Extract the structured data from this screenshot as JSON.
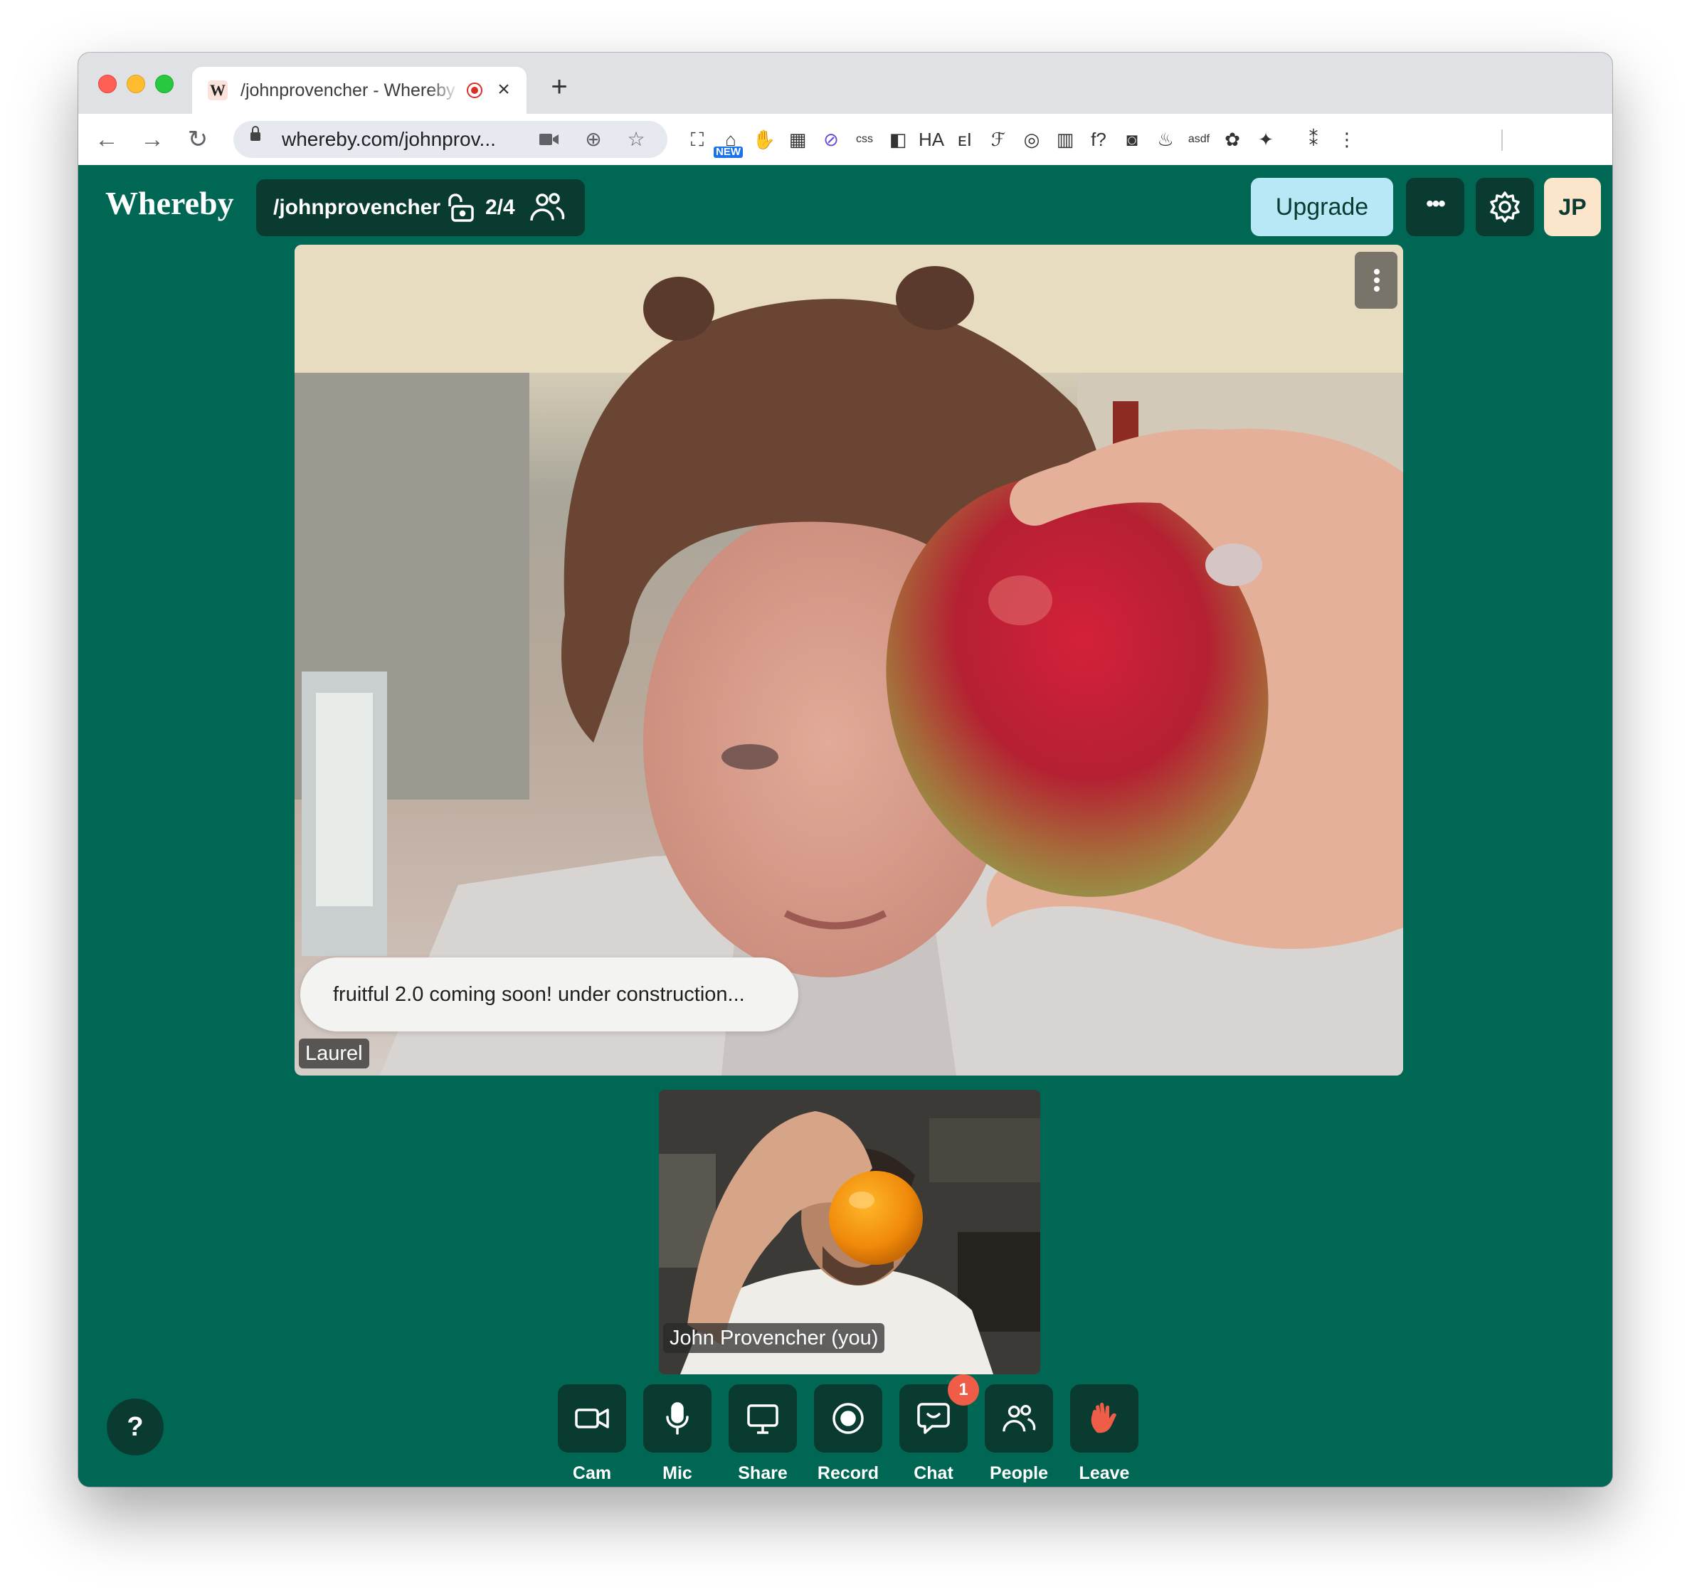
{
  "browser": {
    "tab": {
      "favicon_letter": "W",
      "title": "/johnprovencher - Whereby",
      "recording": true
    },
    "new_tab_label": "+",
    "omnibox": {
      "url": "whereby.com/johnprov..."
    },
    "extensions": [
      {
        "name": "screenshot-extension-icon",
        "glyph": "⛶"
      },
      {
        "name": "new-extension-icon",
        "glyph": "⌂"
      },
      {
        "name": "stop-hand-extension-icon",
        "glyph": "✋"
      },
      {
        "name": "sheets-extension-icon",
        "glyph": "▦"
      },
      {
        "name": "purple-circle-extension-icon",
        "glyph": "⊘"
      },
      {
        "name": "css-extension-icon",
        "glyph": "css"
      },
      {
        "name": "layout-extension-icon",
        "glyph": "◧"
      },
      {
        "name": "ha-extension-icon",
        "glyph": "HA"
      },
      {
        "name": "ei-extension-icon",
        "glyph": "ᴇI"
      },
      {
        "name": "font-extension-icon",
        "glyph": "ℱ"
      },
      {
        "name": "spiral-extension-icon",
        "glyph": "◎"
      },
      {
        "name": "color-bars-extension-icon",
        "glyph": "▥"
      },
      {
        "name": "whatfont-extension-icon",
        "glyph": "f?"
      },
      {
        "name": "camera-extension-icon",
        "glyph": "◙"
      },
      {
        "name": "flame-extension-icon",
        "glyph": "♨"
      },
      {
        "name": "asdf-extension-icon",
        "glyph": "asdf"
      },
      {
        "name": "brain-extension-icon",
        "glyph": "✿"
      },
      {
        "name": "squirrel-extension-icon",
        "glyph": "✦"
      },
      {
        "name": "dots-extension-icon",
        "glyph": "⁑"
      },
      {
        "name": "chrome-menu-icon",
        "glyph": "⋮"
      }
    ]
  },
  "header": {
    "logo": "Whereby",
    "room_name": "/johnprovencher",
    "room_count": "2/4",
    "upgrade_label": "Upgrade",
    "more_label": "•••",
    "avatar_initials": "JP",
    "accent": "#b8e8f6",
    "avatar_bg": "#fbe6cc"
  },
  "main_video": {
    "participant_name": "Laurel",
    "chat_bubble": "fruitful 2.0 coming soon! under construction..."
  },
  "self_video": {
    "participant_name": "John Provencher (you)"
  },
  "help_label": "?",
  "controls": [
    {
      "id": "cam",
      "label": "Cam",
      "icon": "camera-icon"
    },
    {
      "id": "mic",
      "label": "Mic",
      "icon": "microphone-icon"
    },
    {
      "id": "share",
      "label": "Share",
      "icon": "screen-share-icon"
    },
    {
      "id": "record",
      "label": "Record",
      "icon": "record-icon"
    },
    {
      "id": "chat",
      "label": "Chat",
      "icon": "chat-icon",
      "badge": "1"
    },
    {
      "id": "people",
      "label": "People",
      "icon": "people-icon"
    },
    {
      "id": "leave",
      "label": "Leave",
      "icon": "waving-hand-icon"
    }
  ],
  "colors": {
    "app_bg": "#006754",
    "button_bg": "#0a3b30",
    "badge": "#ef5d48",
    "leave_hand": "#ef5d48"
  }
}
